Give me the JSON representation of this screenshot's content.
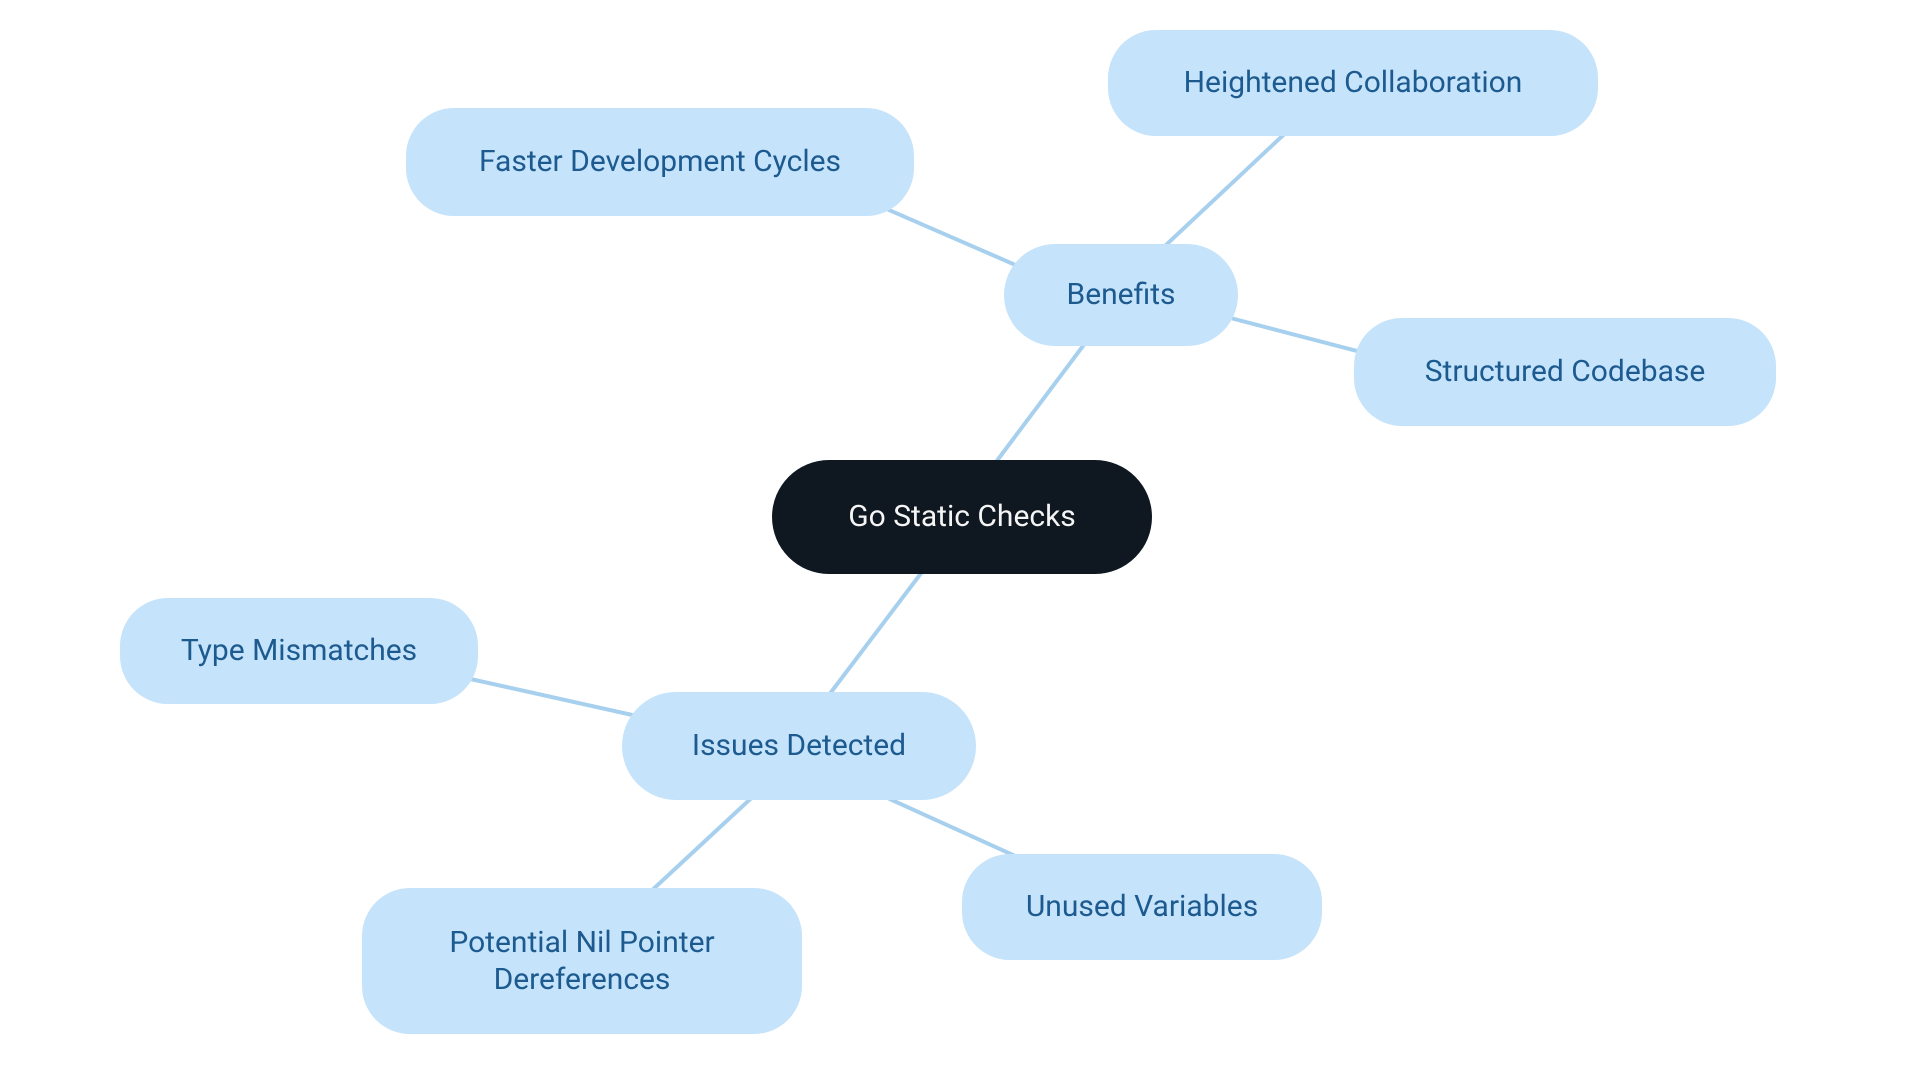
{
  "root": {
    "label": "Go Static Checks"
  },
  "branches": {
    "benefits": {
      "label": "Benefits"
    },
    "issues": {
      "label": "Issues Detected"
    }
  },
  "leaves": {
    "faster_dev": {
      "label": "Faster Development Cycles"
    },
    "heightened_collab": {
      "label": "Heightened Collaboration"
    },
    "structured_codebase": {
      "label": "Structured Codebase"
    },
    "type_mismatches": {
      "label": "Type Mismatches"
    },
    "nil_pointer": {
      "label": "Potential Nil Pointer Dereferences"
    },
    "unused_vars": {
      "label": "Unused Variables"
    }
  },
  "colors": {
    "root_bg": "#0f1720",
    "root_text": "#f5f5f5",
    "node_bg": "#c5e3fa",
    "node_text": "#1c5a8f",
    "line": "#a7d0ee"
  }
}
